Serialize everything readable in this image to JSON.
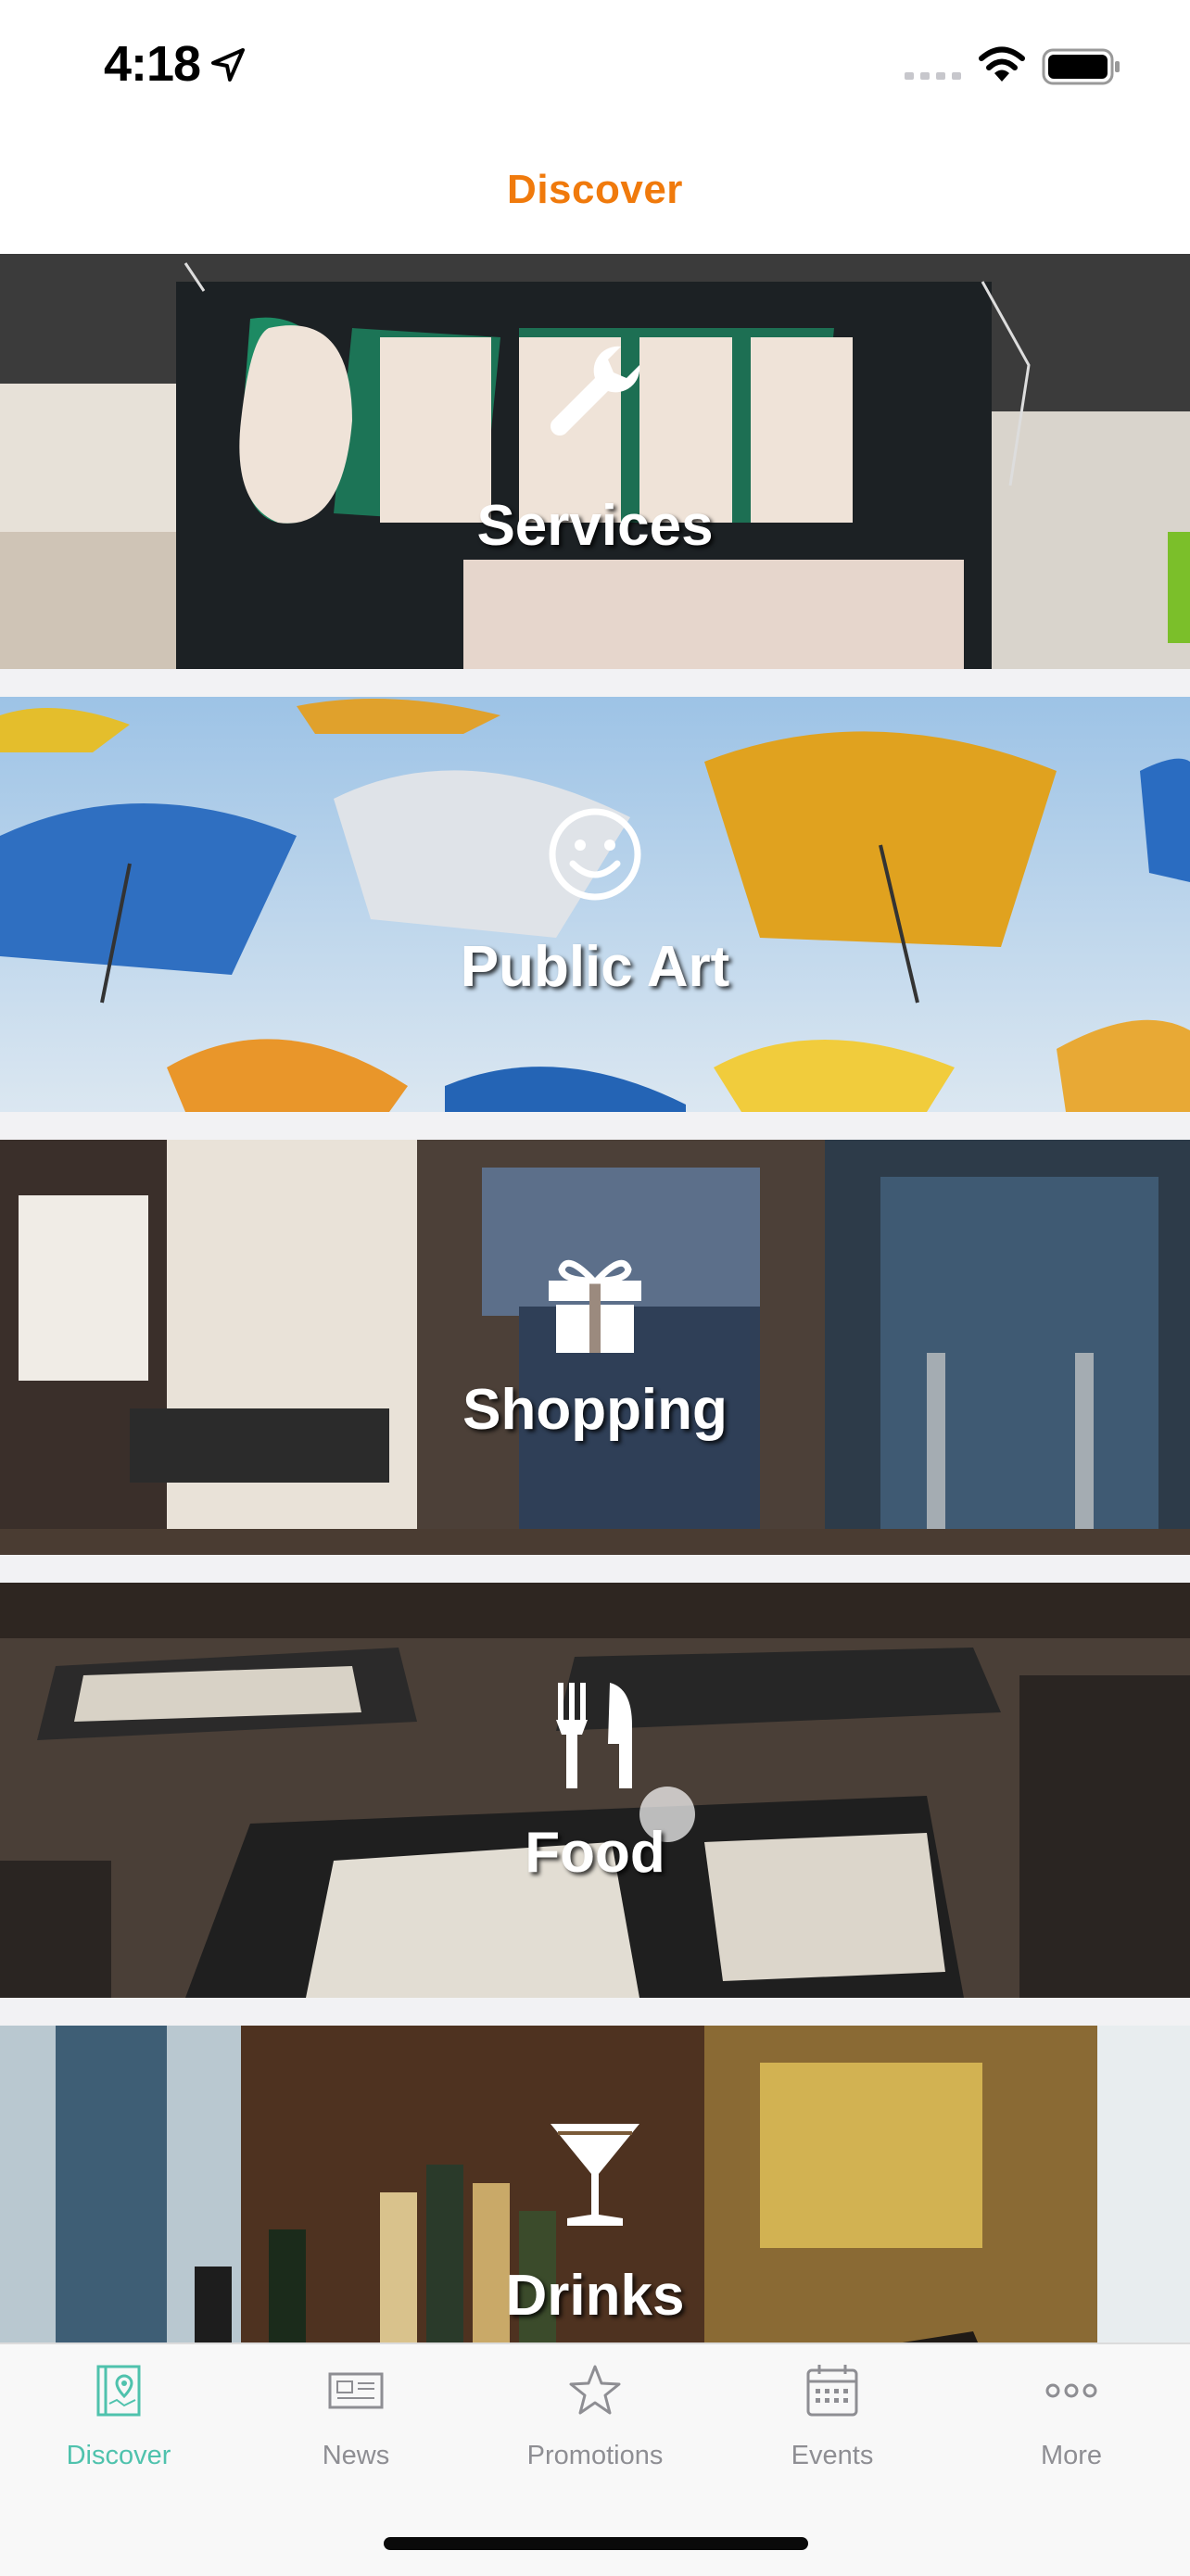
{
  "status_bar": {
    "time": "4:18",
    "icons": [
      "location-arrow-icon",
      "signal-icon",
      "wifi-icon",
      "battery-icon"
    ]
  },
  "nav": {
    "title": "Discover",
    "title_color": "#f07a0c"
  },
  "categories": [
    {
      "label": "Services",
      "icon": "wrench-icon",
      "image": "Order Here sign photo"
    },
    {
      "label": "Public Art",
      "icon": "smiley-icon",
      "image": "umbrellas photo"
    },
    {
      "label": "Shopping",
      "icon": "gift-icon",
      "image": "clothing store photo"
    },
    {
      "label": "Food",
      "icon": "fork-knife-icon",
      "image": "restaurant tables photo"
    },
    {
      "label": "Drinks",
      "icon": "cocktail-glass-icon",
      "image": "bar with bottles photo"
    }
  ],
  "tab_bar": {
    "active_color": "#4fc2ad",
    "inactive_color": "#8e8e93",
    "tabs": [
      {
        "label": "Discover",
        "icon": "map-book-icon",
        "active": true
      },
      {
        "label": "News",
        "icon": "newspaper-icon",
        "active": false
      },
      {
        "label": "Promotions",
        "icon": "star-icon",
        "active": false
      },
      {
        "label": "Events",
        "icon": "calendar-icon",
        "active": false
      },
      {
        "label": "More",
        "icon": "ellipsis-icon",
        "active": false
      }
    ]
  }
}
